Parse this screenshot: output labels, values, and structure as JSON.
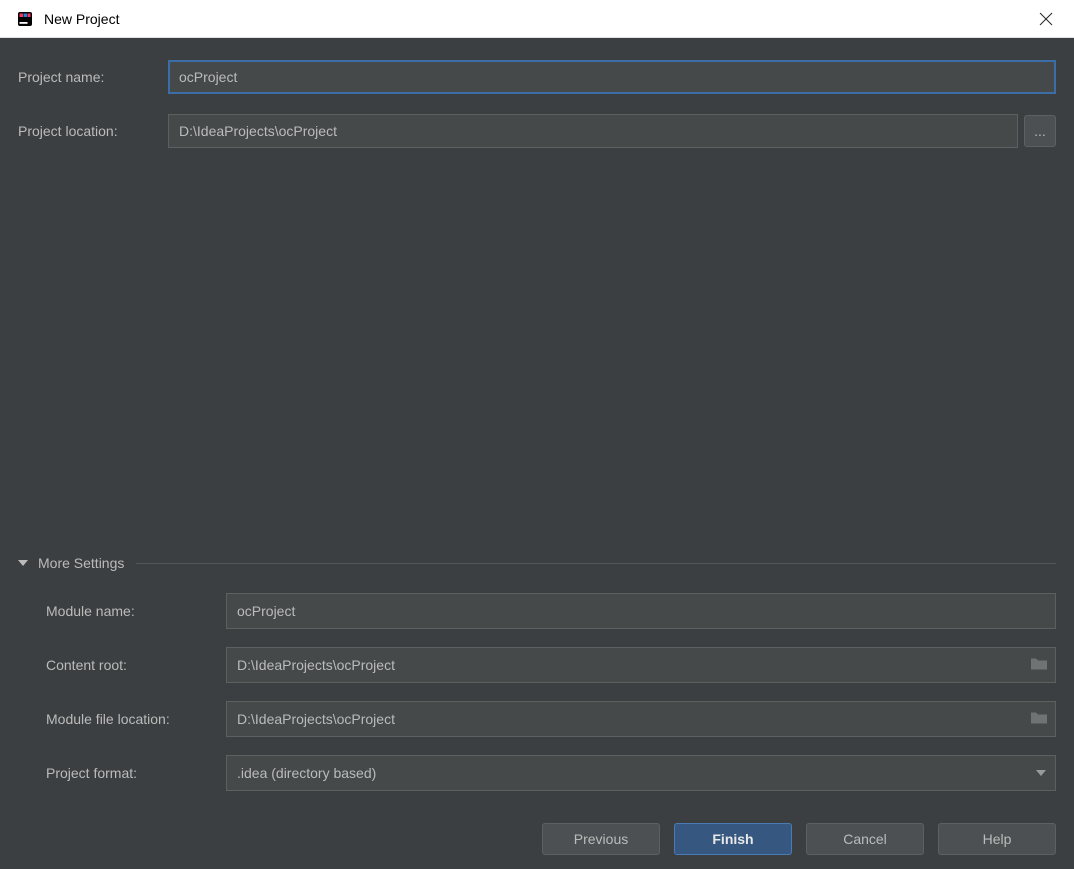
{
  "window": {
    "title": "New Project"
  },
  "form": {
    "project_name_label": "Project name:",
    "project_name_value": "ocProject",
    "project_location_label": "Project location:",
    "project_location_value": "D:\\IdeaProjects\\ocProject",
    "browse_label": "..."
  },
  "more_settings": {
    "header": "More Settings",
    "module_name_label": "Module name:",
    "module_name_value": "ocProject",
    "content_root_label": "Content root:",
    "content_root_value": "D:\\IdeaProjects\\ocProject",
    "module_file_location_label": "Module file location:",
    "module_file_location_value": "D:\\IdeaProjects\\ocProject",
    "project_format_label": "Project format:",
    "project_format_value": ".idea (directory based)"
  },
  "buttons": {
    "previous": "Previous",
    "finish": "Finish",
    "cancel": "Cancel",
    "help": "Help"
  }
}
